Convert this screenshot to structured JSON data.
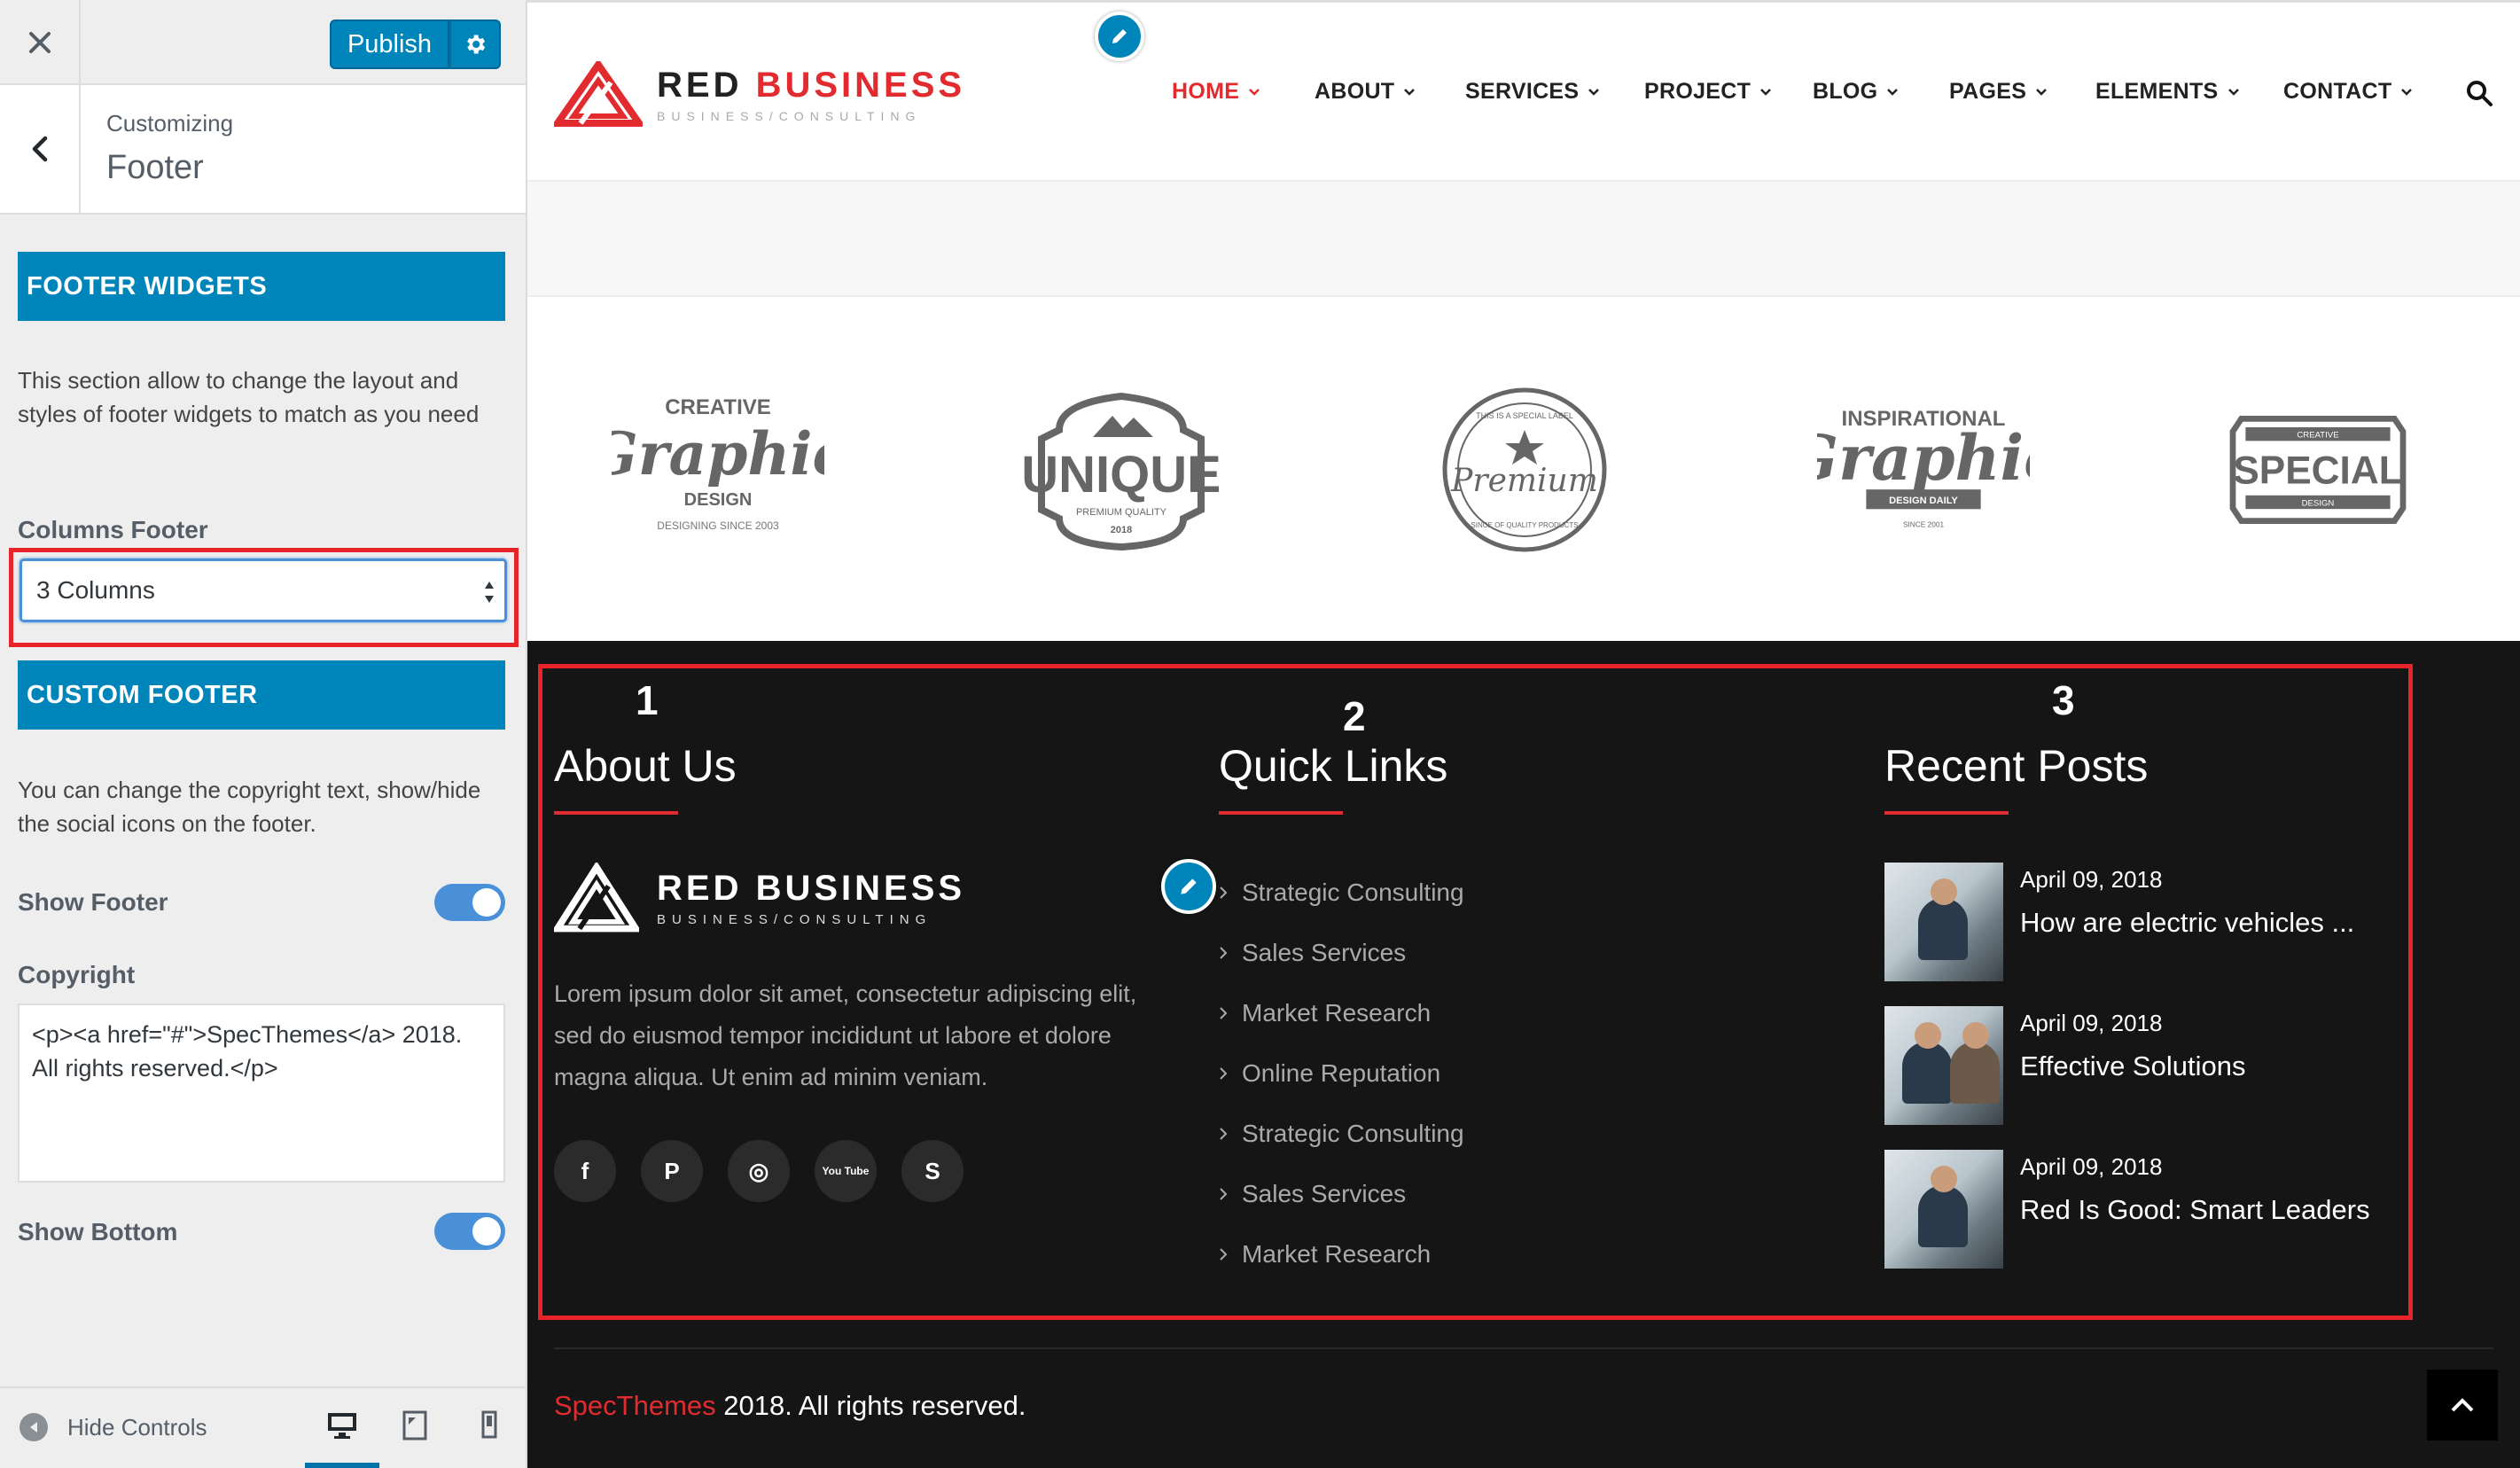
{
  "customizer": {
    "close_icon": "close-icon",
    "publish_label": "Publish",
    "gear_icon": "gear-icon",
    "back_icon": "chevron-left-icon",
    "customizing_label": "Customizing",
    "section_title": "Footer",
    "footer_widgets": {
      "heading": "FOOTER WIDGETS",
      "description": "This section allow to change the layout and styles of footer widgets to match as you need",
      "columns_label": "Columns Footer",
      "columns_value": "3 Columns"
    },
    "custom_footer": {
      "heading": "CUSTOM FOOTER",
      "description": "You can change the copyright text, show/hide the social icons on the footer.",
      "show_footer_label": "Show Footer",
      "show_footer_on": true,
      "copyright_label": "Copyright",
      "copyright_value": "<p><a href=\"#\">SpecThemes</a> 2018. All rights reserved.</p>",
      "show_bottom_label": "Show Bottom",
      "show_bottom_on": true
    },
    "hide_controls_label": "Hide Controls",
    "devices": [
      "desktop-icon",
      "tablet-icon",
      "mobile-icon"
    ],
    "accent_color": "#0085ba"
  },
  "site": {
    "logo": {
      "main_a": "RED ",
      "main_b": "BUSINESS",
      "sub": "BUSINESS/CONSULTING"
    },
    "nav": [
      {
        "label": "HOME",
        "active": true
      },
      {
        "label": "ABOUT"
      },
      {
        "label": "SERVICES"
      },
      {
        "label": "PROJECT"
      },
      {
        "label": "BLOG"
      },
      {
        "label": "PAGES"
      },
      {
        "label": "ELEMENTS"
      },
      {
        "label": "CONTACT"
      }
    ],
    "brands": [
      {
        "top": "CREATIVE",
        "main": "Graphic",
        "sub": "DESIGN",
        "foot": "DESIGNING SINCE 2003"
      },
      {
        "main": "UNIQUE",
        "sub": "PREMIUM QUALITY",
        "foot": "2018"
      },
      {
        "top": "THIS IS A SPECIAL LABEL",
        "main": "Premium",
        "foot": "SINCE OF QUALITY PRODUCTS"
      },
      {
        "top": "INSPIRATIONAL",
        "main": "Graphic",
        "sub": "DESIGN DAILY",
        "foot": "SINCE 2001"
      },
      {
        "top": "CREATIVE",
        "main": "SPECIAL",
        "sub": "DESIGN"
      }
    ],
    "footer": {
      "col1": {
        "number": "1",
        "title": "About Us",
        "text": "Lorem ipsum dolor sit amet, consectetur adipiscing elit, sed do eiusmod tempor incididunt ut labore et dolore magna aliqua. Ut enim ad minim veniam.",
        "socials": [
          "f",
          "P",
          "◎",
          "You Tube",
          "S"
        ]
      },
      "col2": {
        "number": "2",
        "title": "Quick Links",
        "links": [
          "Strategic Consulting",
          "Sales Services",
          "Market Research",
          "Online Reputation",
          "Strategic Consulting",
          "Sales Services",
          "Market Research"
        ]
      },
      "col3": {
        "number": "3",
        "title": "Recent Posts",
        "posts": [
          {
            "date": "April 09, 2018",
            "title": "How are electric vehicles ..."
          },
          {
            "date": "April 09, 2018",
            "title": "Effective Solutions"
          },
          {
            "date": "April 09, 2018",
            "title": "Red Is Good: Smart Leaders"
          }
        ]
      },
      "copyright_brand": "SpecThemes",
      "copyright_text": " 2018. All rights reserved."
    },
    "brand_red": "#e22b2f",
    "footer_bg": "#151515"
  }
}
